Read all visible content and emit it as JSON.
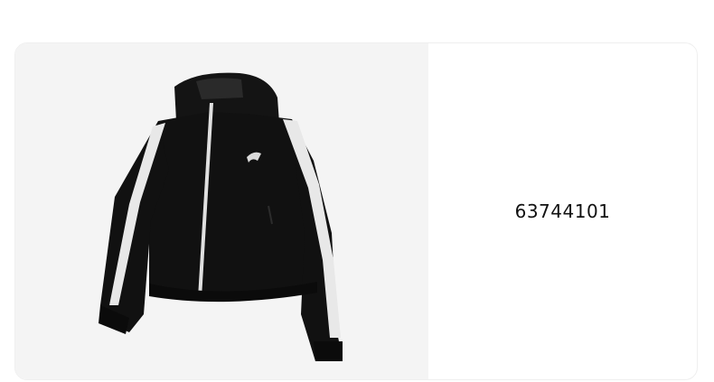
{
  "product": {
    "image_icon": "black-zip-hoodie-jacket-image",
    "sku": "63744101"
  },
  "colors": {
    "image_bg": "#f4f4f4",
    "jacket": "#111111",
    "stripe": "#e8e8e8"
  }
}
